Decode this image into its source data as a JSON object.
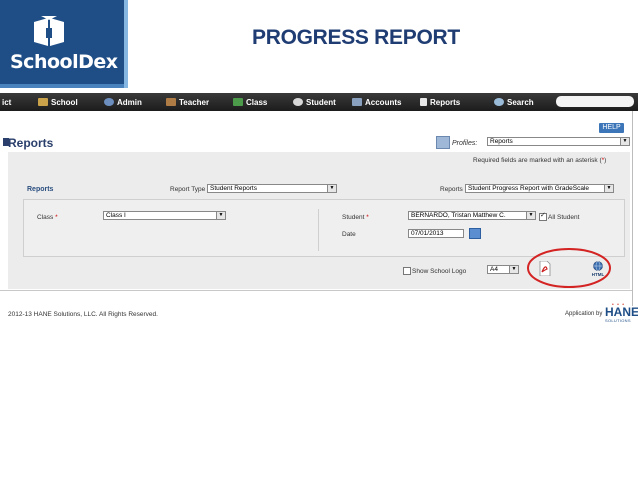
{
  "brand": {
    "name": "SchoolDex",
    "band_color": "#1f4e86"
  },
  "slide": {
    "title": "PROGRESS REPORT",
    "title_color": "#1f3c73"
  },
  "nav": {
    "items": [
      {
        "label": "ict",
        "icon": "cut-off-icon"
      },
      {
        "label": "School",
        "icon": "school-icon"
      },
      {
        "label": "Admin",
        "icon": "admin-icon"
      },
      {
        "label": "Teacher",
        "icon": "teacher-icon"
      },
      {
        "label": "Class",
        "icon": "class-icon"
      },
      {
        "label": "Student",
        "icon": "student-icon"
      },
      {
        "label": "Accounts",
        "icon": "accounts-icon"
      },
      {
        "label": "Reports",
        "icon": "reports-icon"
      },
      {
        "label": "Search",
        "icon": "search-icon"
      }
    ]
  },
  "page": {
    "title": "Reports",
    "help_label": "HELP",
    "profiles_label": "Profiles:",
    "profiles_value": "Reports",
    "required_note_prefix": "Required fields are marked with an asterisk (",
    "required_note_star": "*",
    "required_note_suffix": ")"
  },
  "form": {
    "section_label": "Reports",
    "report_type_label": "Report Type",
    "report_type_value": "Student Reports",
    "reports_label": "Reports",
    "reports_value": "Student Progress Report with GradeScale",
    "class_label": "Class",
    "class_value": "Class I",
    "student_label": "Student",
    "student_value": "BERNARDO, Tristan Matthew C.",
    "all_student_label": "All Student",
    "all_student_checked": true,
    "date_label": "Date",
    "date_value": "07/01/2013",
    "show_logo_label": "Show School Logo",
    "show_logo_checked": false,
    "paper_size_value": "A4",
    "asterisk": "*"
  },
  "export": {
    "pdf_icon": "pdf-icon",
    "html_icon": "html-icon",
    "html_label": "HTML",
    "highlight_color": "#d42323"
  },
  "footer": {
    "copyright": "2012-13 HANE Solutions, LLC. All Rights Reserved.",
    "app_by": "Application by",
    "company_logo_text": "HANE",
    "company_logo_sub": "SOLUTIONS"
  }
}
